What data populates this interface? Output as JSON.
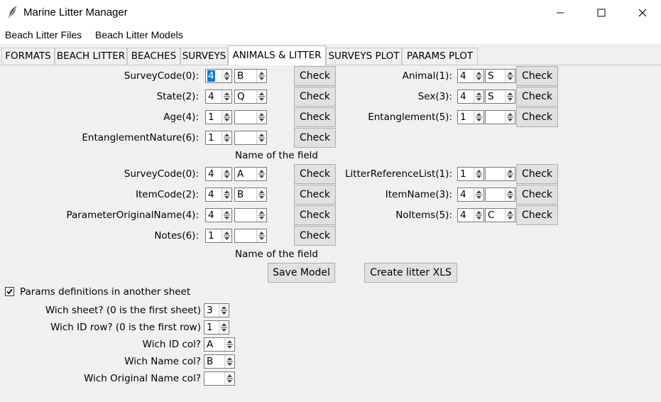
{
  "window": {
    "title": "Marine Litter Manager",
    "minimize": "—",
    "maximize": "☐",
    "close": "✕"
  },
  "menu": [
    "Beach Litter Files",
    "Beach Litter Models"
  ],
  "tabs": [
    "FORMATS",
    "BEACH LITTER",
    "BEACHES",
    "SURVEYS",
    "ANIMALS & LITTER",
    "SURVEYS PLOT",
    "PARAMS PLOT"
  ],
  "active_tab": "ANIMALS & LITTER",
  "animals": {
    "left": [
      {
        "label": "SurveyCode(0):",
        "num": "4",
        "col": "B",
        "check": "Check"
      },
      {
        "label": "State(2):",
        "num": "4",
        "col": "Q",
        "check": "Check"
      },
      {
        "label": "Age(4):",
        "num": "1",
        "col": "",
        "check": "Check"
      },
      {
        "label": "EntanglementNature(6):",
        "num": "1",
        "col": "",
        "check": "Check"
      }
    ],
    "right": [
      {
        "label": "Animal(1):",
        "num": "4",
        "col": "S",
        "check": "Check"
      },
      {
        "label": "Sex(3):",
        "num": "4",
        "col": "S",
        "check": "Check"
      },
      {
        "label": "Entanglement(5):",
        "num": "1",
        "col": "",
        "check": "Check"
      }
    ],
    "caption": "Name of the field"
  },
  "litter": {
    "left": [
      {
        "label": "SurveyCode(0):",
        "num": "4",
        "col": "A",
        "check": "Check"
      },
      {
        "label": "ItemCode(2):",
        "num": "4",
        "col": "B",
        "check": "Check"
      },
      {
        "label": "ParameterOriginalName(4):",
        "num": "4",
        "col": "",
        "check": "Check"
      },
      {
        "label": "Notes(6):",
        "num": "1",
        "col": "",
        "check": "Check"
      }
    ],
    "right": [
      {
        "label": "LitterReferenceList(1):",
        "num": "1",
        "col": "",
        "check": "Check"
      },
      {
        "label": "ItemName(3):",
        "num": "4",
        "col": "",
        "check": "Check"
      },
      {
        "label": "NoItems(5):",
        "num": "4",
        "col": "C",
        "check": "Check"
      }
    ],
    "caption": "Name of the field"
  },
  "buttons": {
    "save": "Save Model",
    "create": "Create litter XLS"
  },
  "params": {
    "checkbox_label": "Params definitions in another sheet",
    "checked": true,
    "rows": [
      {
        "label": "Wich sheet? (0 is the first sheet)",
        "value": "3"
      },
      {
        "label": "Wich ID row? (0 is the first row)",
        "value": "1"
      },
      {
        "label": "Wich ID col?",
        "value": "A"
      },
      {
        "label": "Wich Name col?",
        "value": "B"
      },
      {
        "label": "Wich Original Name col?",
        "value": ""
      }
    ]
  }
}
